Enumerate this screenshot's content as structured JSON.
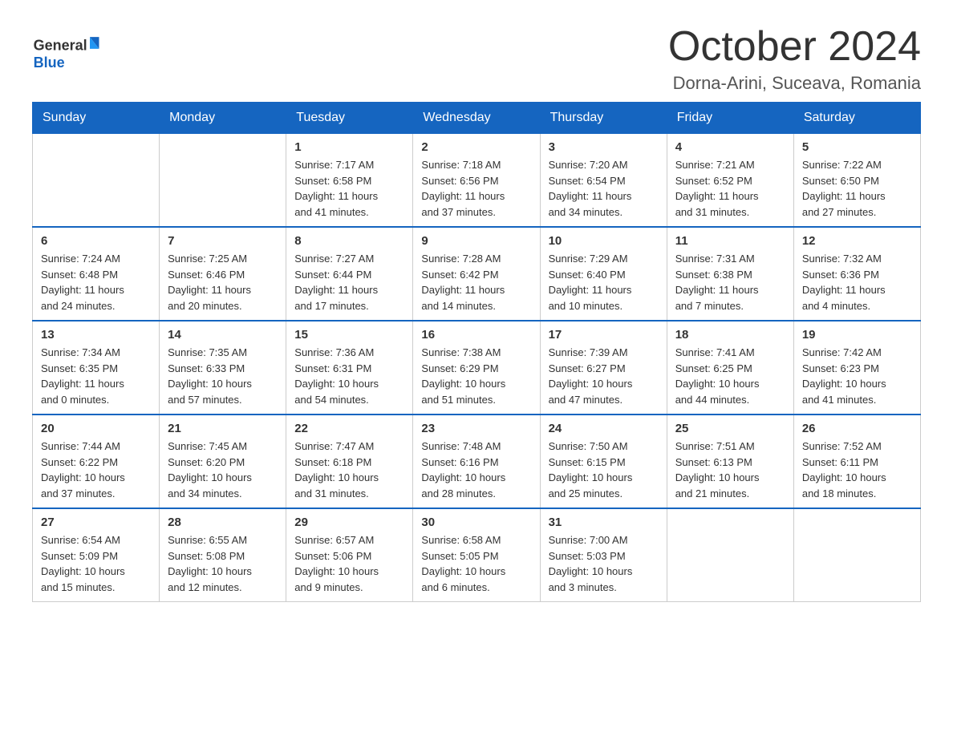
{
  "logo": {
    "text_general": "General",
    "text_blue": "Blue",
    "aria": "GeneralBlue logo"
  },
  "title": "October 2024",
  "subtitle": "Dorna-Arini, Suceava, Romania",
  "days_of_week": [
    "Sunday",
    "Monday",
    "Tuesday",
    "Wednesday",
    "Thursday",
    "Friday",
    "Saturday"
  ],
  "weeks": [
    [
      {
        "day": "",
        "info": ""
      },
      {
        "day": "",
        "info": ""
      },
      {
        "day": "1",
        "info": "Sunrise: 7:17 AM\nSunset: 6:58 PM\nDaylight: 11 hours\nand 41 minutes."
      },
      {
        "day": "2",
        "info": "Sunrise: 7:18 AM\nSunset: 6:56 PM\nDaylight: 11 hours\nand 37 minutes."
      },
      {
        "day": "3",
        "info": "Sunrise: 7:20 AM\nSunset: 6:54 PM\nDaylight: 11 hours\nand 34 minutes."
      },
      {
        "day": "4",
        "info": "Sunrise: 7:21 AM\nSunset: 6:52 PM\nDaylight: 11 hours\nand 31 minutes."
      },
      {
        "day": "5",
        "info": "Sunrise: 7:22 AM\nSunset: 6:50 PM\nDaylight: 11 hours\nand 27 minutes."
      }
    ],
    [
      {
        "day": "6",
        "info": "Sunrise: 7:24 AM\nSunset: 6:48 PM\nDaylight: 11 hours\nand 24 minutes."
      },
      {
        "day": "7",
        "info": "Sunrise: 7:25 AM\nSunset: 6:46 PM\nDaylight: 11 hours\nand 20 minutes."
      },
      {
        "day": "8",
        "info": "Sunrise: 7:27 AM\nSunset: 6:44 PM\nDaylight: 11 hours\nand 17 minutes."
      },
      {
        "day": "9",
        "info": "Sunrise: 7:28 AM\nSunset: 6:42 PM\nDaylight: 11 hours\nand 14 minutes."
      },
      {
        "day": "10",
        "info": "Sunrise: 7:29 AM\nSunset: 6:40 PM\nDaylight: 11 hours\nand 10 minutes."
      },
      {
        "day": "11",
        "info": "Sunrise: 7:31 AM\nSunset: 6:38 PM\nDaylight: 11 hours\nand 7 minutes."
      },
      {
        "day": "12",
        "info": "Sunrise: 7:32 AM\nSunset: 6:36 PM\nDaylight: 11 hours\nand 4 minutes."
      }
    ],
    [
      {
        "day": "13",
        "info": "Sunrise: 7:34 AM\nSunset: 6:35 PM\nDaylight: 11 hours\nand 0 minutes."
      },
      {
        "day": "14",
        "info": "Sunrise: 7:35 AM\nSunset: 6:33 PM\nDaylight: 10 hours\nand 57 minutes."
      },
      {
        "day": "15",
        "info": "Sunrise: 7:36 AM\nSunset: 6:31 PM\nDaylight: 10 hours\nand 54 minutes."
      },
      {
        "day": "16",
        "info": "Sunrise: 7:38 AM\nSunset: 6:29 PM\nDaylight: 10 hours\nand 51 minutes."
      },
      {
        "day": "17",
        "info": "Sunrise: 7:39 AM\nSunset: 6:27 PM\nDaylight: 10 hours\nand 47 minutes."
      },
      {
        "day": "18",
        "info": "Sunrise: 7:41 AM\nSunset: 6:25 PM\nDaylight: 10 hours\nand 44 minutes."
      },
      {
        "day": "19",
        "info": "Sunrise: 7:42 AM\nSunset: 6:23 PM\nDaylight: 10 hours\nand 41 minutes."
      }
    ],
    [
      {
        "day": "20",
        "info": "Sunrise: 7:44 AM\nSunset: 6:22 PM\nDaylight: 10 hours\nand 37 minutes."
      },
      {
        "day": "21",
        "info": "Sunrise: 7:45 AM\nSunset: 6:20 PM\nDaylight: 10 hours\nand 34 minutes."
      },
      {
        "day": "22",
        "info": "Sunrise: 7:47 AM\nSunset: 6:18 PM\nDaylight: 10 hours\nand 31 minutes."
      },
      {
        "day": "23",
        "info": "Sunrise: 7:48 AM\nSunset: 6:16 PM\nDaylight: 10 hours\nand 28 minutes."
      },
      {
        "day": "24",
        "info": "Sunrise: 7:50 AM\nSunset: 6:15 PM\nDaylight: 10 hours\nand 25 minutes."
      },
      {
        "day": "25",
        "info": "Sunrise: 7:51 AM\nSunset: 6:13 PM\nDaylight: 10 hours\nand 21 minutes."
      },
      {
        "day": "26",
        "info": "Sunrise: 7:52 AM\nSunset: 6:11 PM\nDaylight: 10 hours\nand 18 minutes."
      }
    ],
    [
      {
        "day": "27",
        "info": "Sunrise: 6:54 AM\nSunset: 5:09 PM\nDaylight: 10 hours\nand 15 minutes."
      },
      {
        "day": "28",
        "info": "Sunrise: 6:55 AM\nSunset: 5:08 PM\nDaylight: 10 hours\nand 12 minutes."
      },
      {
        "day": "29",
        "info": "Sunrise: 6:57 AM\nSunset: 5:06 PM\nDaylight: 10 hours\nand 9 minutes."
      },
      {
        "day": "30",
        "info": "Sunrise: 6:58 AM\nSunset: 5:05 PM\nDaylight: 10 hours\nand 6 minutes."
      },
      {
        "day": "31",
        "info": "Sunrise: 7:00 AM\nSunset: 5:03 PM\nDaylight: 10 hours\nand 3 minutes."
      },
      {
        "day": "",
        "info": ""
      },
      {
        "day": "",
        "info": ""
      }
    ]
  ]
}
